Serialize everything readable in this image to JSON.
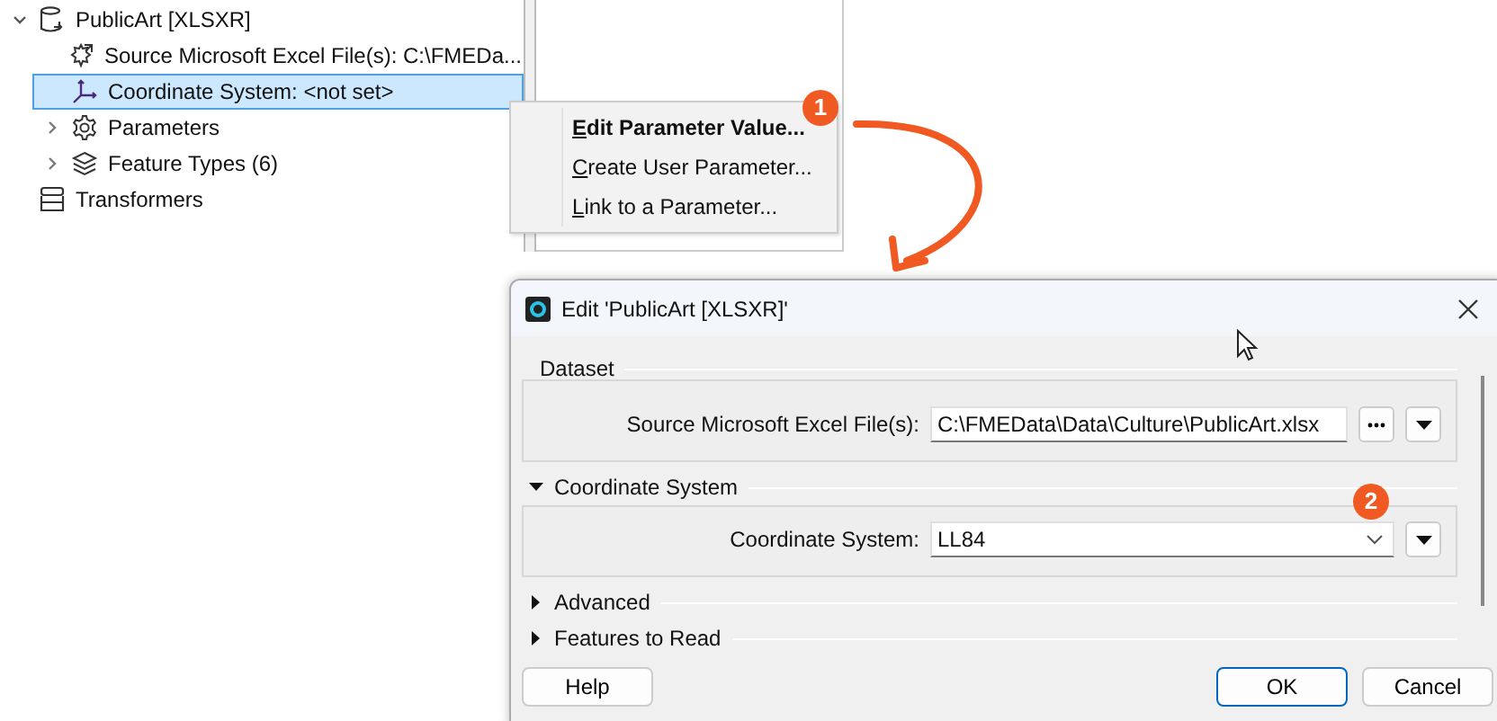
{
  "tree": [
    {
      "label": "PublicArt [XLSXR]",
      "kind": "dataset",
      "expanded": true,
      "selected": false,
      "children": [
        {
          "label": "Source Microsoft Excel File(s): C:\\FMEDa...",
          "kind": "param",
          "selected": false
        },
        {
          "label": "Coordinate System: <not set>",
          "kind": "coord",
          "selected": true
        },
        {
          "label": "Parameters",
          "kind": "gear",
          "expanded": false,
          "selected": false
        },
        {
          "label": "Feature Types (6)",
          "kind": "layers",
          "expanded": false,
          "selected": false
        }
      ]
    },
    {
      "label": "Transformers",
      "kind": "stack",
      "selected": false
    }
  ],
  "context_menu": {
    "items": [
      {
        "label": "Edit Parameter Value...",
        "default": true
      },
      {
        "label": "Create User Parameter...",
        "default": false
      },
      {
        "label": "Link to a Parameter...",
        "default": false
      }
    ]
  },
  "callouts": [
    "1",
    "2"
  ],
  "dialog": {
    "title": "Edit 'PublicArt [XLSXR]'",
    "sections": [
      {
        "title": "Dataset",
        "kind": "group",
        "fields": [
          {
            "label": "Source Microsoft Excel File(s):",
            "value": "C:\\FMEData\\Data\\Culture\\PublicArt.xlsx",
            "kind": "file"
          }
        ]
      },
      {
        "title": "Coordinate System",
        "kind": "collapsible",
        "expanded": true,
        "fields": [
          {
            "label": "Coordinate System:",
            "value": "LL84",
            "kind": "combo"
          }
        ]
      },
      {
        "title": "Advanced",
        "kind": "collapsible",
        "expanded": false
      },
      {
        "title": "Features to Read",
        "kind": "collapsible",
        "expanded": false
      }
    ],
    "buttons": [
      {
        "label": "Help",
        "default": false
      },
      {
        "label": "OK",
        "default": true
      },
      {
        "label": "Cancel",
        "default": false
      }
    ]
  }
}
